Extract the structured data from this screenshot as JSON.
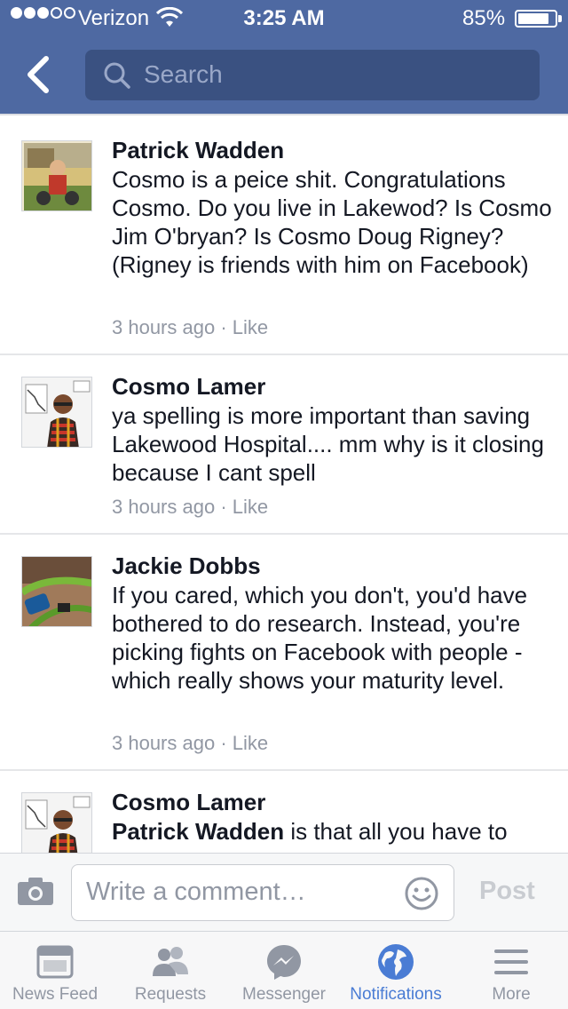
{
  "status_bar": {
    "carrier": "Verizon",
    "time": "3:25 AM",
    "battery_percent": "85%",
    "battery_level": 0.85,
    "signal_bars_filled": 3,
    "signal_bars_total": 5
  },
  "header": {
    "search_placeholder": "Search",
    "icons": [
      "chevron-left-icon",
      "search-icon"
    ]
  },
  "comments": [
    {
      "author": "Patrick Wadden",
      "text": "Cosmo is a peice shit. Congratulations Cosmo. Do you live in Lakewod?  Is Cosmo Jim O'bryan?  Is Cosmo Doug Rigney? (Rigney is friends with him on Facebook)",
      "time": "3 hours ago",
      "separator": "·",
      "like": "Like"
    },
    {
      "author": "Cosmo Lamer",
      "text": "ya spelling is more important than saving Lakewood Hospital.... mm why is it closing because I cant spell",
      "time": "3 hours ago",
      "separator": "·",
      "like": "Like"
    },
    {
      "author": "Jackie Dobbs",
      "text": "If you cared, which you don't, you'd have bothered to do research. Instead, you're picking fights on Facebook with people - which really shows your maturity level.",
      "time": "3 hours ago",
      "separator": "·",
      "like": "Like"
    },
    {
      "author": "Cosmo Lamer",
      "mention": "Patrick Wadden",
      "text": " is that all you have to"
    }
  ],
  "composer": {
    "placeholder": "Write a comment…",
    "post_label": "Post",
    "icons": [
      "camera-icon",
      "smiley-icon"
    ]
  },
  "tabs": [
    {
      "label": "News Feed",
      "icon": "news-feed-icon",
      "active": false
    },
    {
      "label": "Requests",
      "icon": "friends-icon",
      "active": false
    },
    {
      "label": "Messenger",
      "icon": "messenger-icon",
      "active": false
    },
    {
      "label": "Notifications",
      "icon": "globe-icon",
      "active": true
    },
    {
      "label": "More",
      "icon": "menu-icon",
      "active": false
    }
  ],
  "colors": {
    "header_blue": "#4e69a2",
    "search_field": "#3a5181",
    "active_tab": "#4a7cd4",
    "inactive_gray": "#9197a3"
  }
}
